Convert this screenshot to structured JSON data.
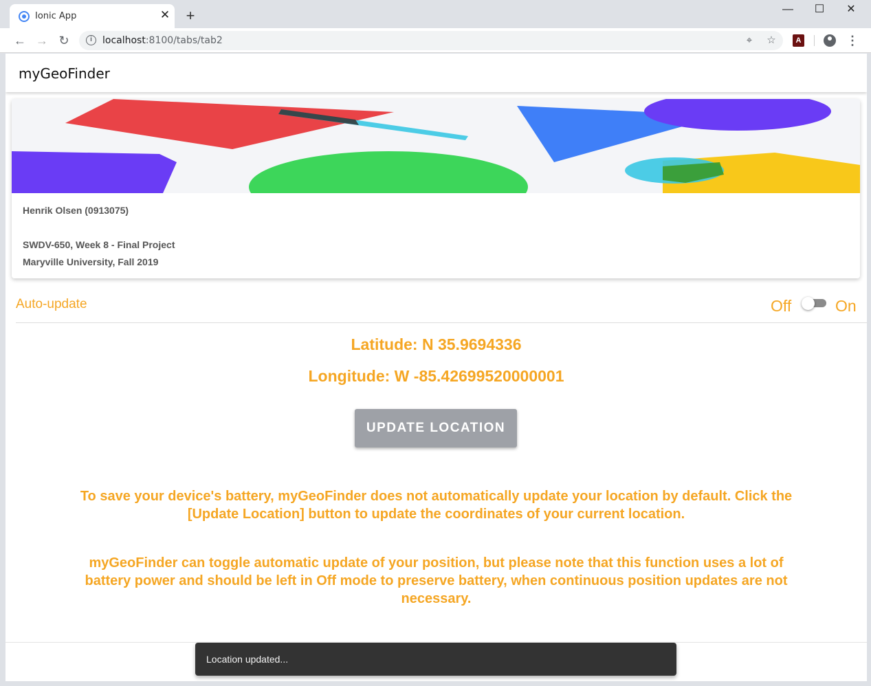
{
  "browser": {
    "tab_title": "Ionic App",
    "tab_close": "✕",
    "new_tab": "+",
    "window_controls": {
      "minimize": "—",
      "maximize": "☐",
      "close": "✕"
    },
    "nav": {
      "back": "←",
      "forward": "→",
      "reload": "↻"
    },
    "url_host": "localhost",
    "url_path": ":8100/tabs/tab2",
    "icons": [
      "location-icon",
      "star-icon",
      "pdf-extension-icon",
      "profile-icon",
      "menu-icon"
    ]
  },
  "app": {
    "title": "myGeoFinder",
    "card": {
      "author": "Henrik Olsen (0913075)",
      "course": "SWDV-650, Week 8 - Final Project",
      "school": "Maryville University, Fall 2019"
    },
    "auto_update": {
      "label": "Auto-update",
      "off_label": "Off",
      "on_label": "On",
      "enabled": false
    },
    "latitude": "Latitude: N 35.9694336",
    "longitude": "Longitude: W -85.42699520000001",
    "update_button": "UPDATE LOCATION",
    "info_text_1": "To save your device's battery, myGeoFinder does not automatically update your location by default. Click the [Update Location] button to update the coordinates of your current location.",
    "info_text_2": "myGeoFinder can toggle automatic update of your position, but please note that this function uses a lot of battery power and should be left in Off mode to preserve battery, when continuous position updates are not necessary.",
    "toast": "Location updated...",
    "colors": {
      "accent": "#f5a623",
      "button": "#9ea1a7",
      "toast": "#333333"
    }
  }
}
